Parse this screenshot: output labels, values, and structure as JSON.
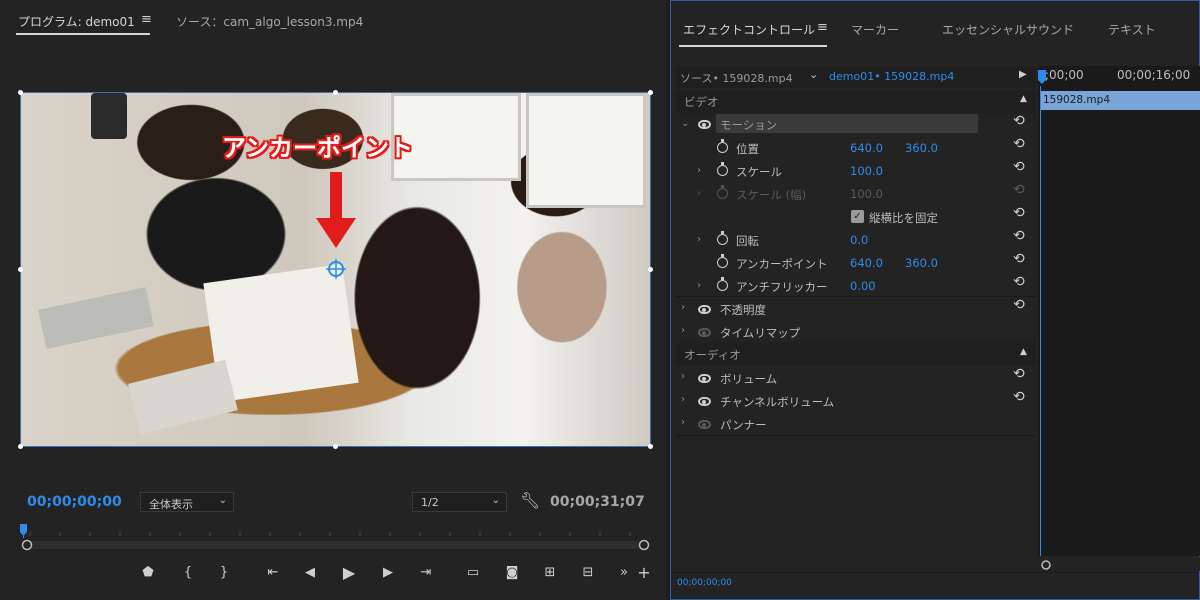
{
  "program": {
    "tab_program": "プログラム: demo01",
    "tab_source": "ソース：cam_algo_lesson3.mp4",
    "menu_icon": "hamburger-icon",
    "annotation_label": "アンカーポイント",
    "timecode_current": "00;00;00;00",
    "zoom_select": "全体表示",
    "resolution_select": "1/2",
    "timecode_duration": "00;00;31;07",
    "buttons": [
      "marker-icon",
      "mark-in-icon",
      "mark-out-icon",
      "go-to-in-icon",
      "step-back-icon",
      "play-icon",
      "step-forward-icon",
      "go-to-out-icon",
      "safe-margins-icon",
      "camera-icon",
      "insert-icon",
      "overwrite-icon",
      "more-icon",
      "add-icon"
    ]
  },
  "effect_panel": {
    "tab_effect_controls": "エフェクトコントロール",
    "tab_markers": "マーカー",
    "tab_essential_sound": "エッセンシャルサウンド",
    "tab_text": "テキスト",
    "source_clip": "ソース• 159028.mp4",
    "sequence_clip": "demo01• 159028.mp4",
    "timeline_start": ";00;00",
    "timeline_mid": "00;00;16;00",
    "clip_bar": "159028.mp4",
    "video_header": "ビデオ",
    "audio_header": "オーディオ",
    "footer_timecode": "00;00;00;00",
    "rows": {
      "motion": "モーション",
      "position": "位置",
      "position_x": "640.0",
      "position_y": "360.0",
      "scale": "スケール",
      "scale_value": "100.0",
      "scale_width": "スケール (幅)",
      "scale_width_value": "100.0",
      "uniform_scale": "縦横比を固定",
      "rotation": "回転",
      "rotation_value": "0.0",
      "anchor_point": "アンカーポイント",
      "anchor_x": "640.0",
      "anchor_y": "360.0",
      "anti_flicker": "アンチフリッカー",
      "anti_flicker_value": "0.00",
      "opacity": "不透明度",
      "time_remap": "タイムリマップ",
      "volume": "ボリューム",
      "channel_volume": "チャンネルボリューム",
      "panner": "パンナー"
    }
  },
  "colors": {
    "accent_blue": "#2d8ceb",
    "annotation_red": "#e21b1b",
    "panel_bg": "#232323"
  }
}
